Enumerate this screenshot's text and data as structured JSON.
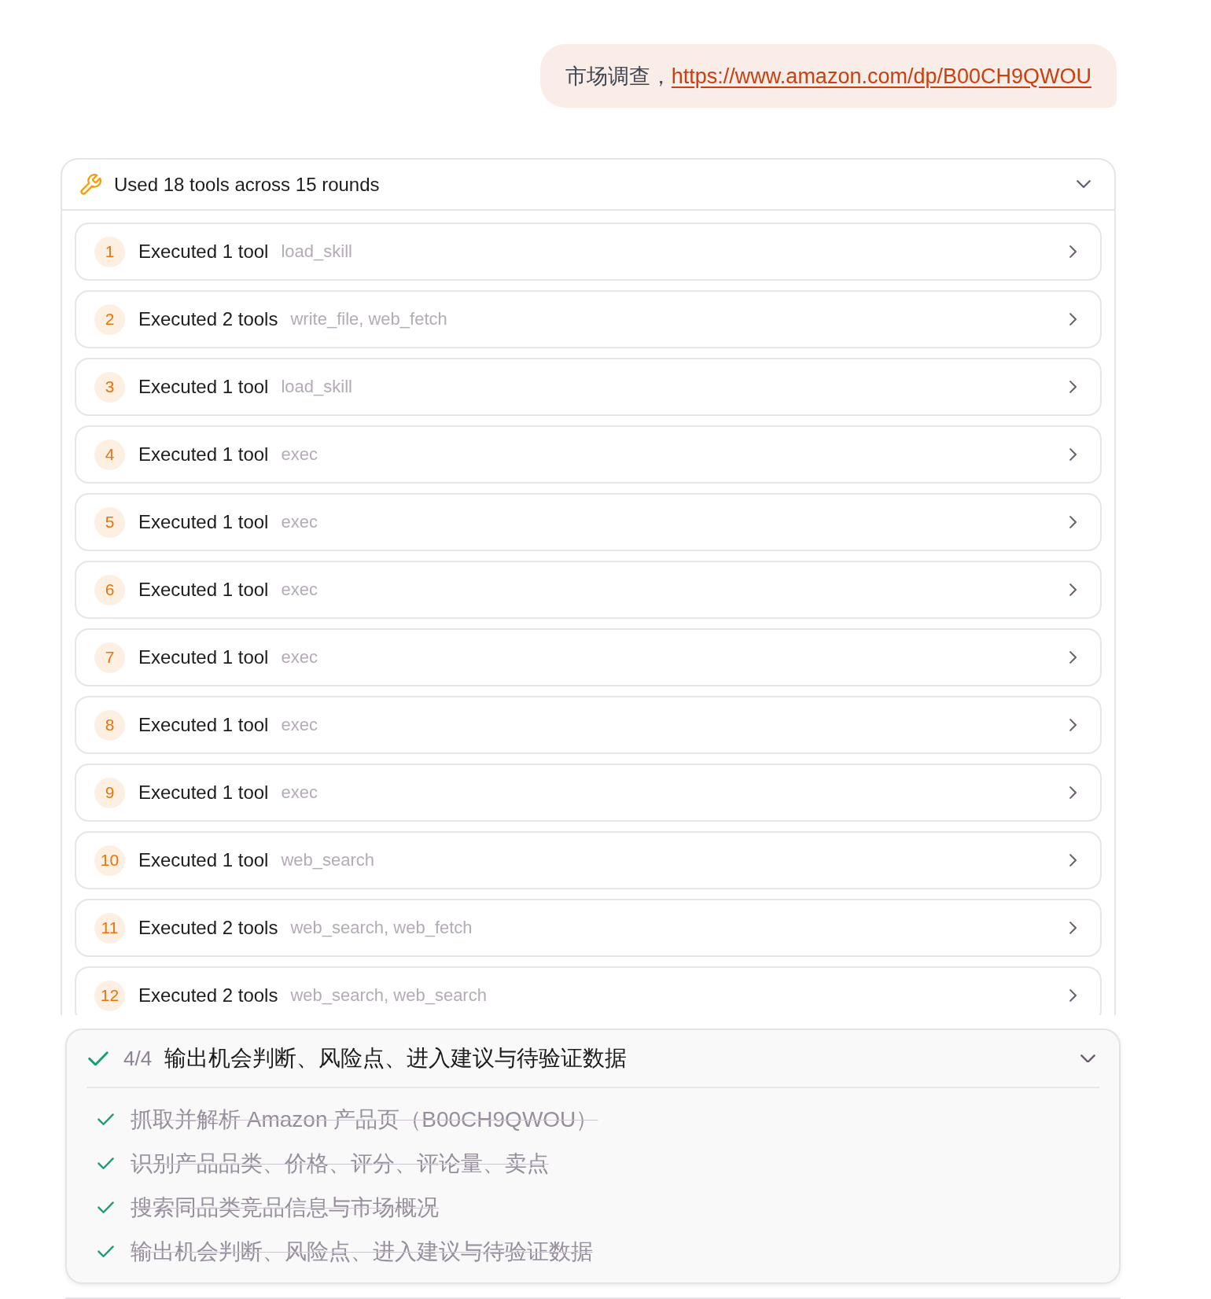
{
  "user_message": {
    "text": "市场调查，",
    "link": "https://www.amazon.com/dp/B00CH9QWOU"
  },
  "tool_summary": {
    "title": "Used 18 tools across 15 rounds",
    "expanded": true,
    "rounds": [
      {
        "number": "1",
        "label": "Executed 1 tool",
        "tools": "load_skill",
        "expanded": false
      },
      {
        "number": "2",
        "label": "Executed 2 tools",
        "tools": "write_file, web_fetch",
        "expanded": false
      },
      {
        "number": "3",
        "label": "Executed 1 tool",
        "tools": "load_skill",
        "expanded": false
      },
      {
        "number": "4",
        "label": "Executed 1 tool",
        "tools": "exec",
        "expanded": false
      },
      {
        "number": "5",
        "label": "Executed 1 tool",
        "tools": "exec",
        "expanded": false
      },
      {
        "number": "6",
        "label": "Executed 1 tool",
        "tools": "exec",
        "expanded": false
      },
      {
        "number": "7",
        "label": "Executed 1 tool",
        "tools": "exec",
        "expanded": false
      },
      {
        "number": "8",
        "label": "Executed 1 tool",
        "tools": "exec",
        "expanded": false
      },
      {
        "number": "9",
        "label": "Executed 1 tool",
        "tools": "exec",
        "expanded": false
      },
      {
        "number": "10",
        "label": "Executed 1 tool",
        "tools": "web_search",
        "expanded": false
      },
      {
        "number": "11",
        "label": "Executed 2 tools",
        "tools": "web_search, web_fetch",
        "expanded": false
      },
      {
        "number": "12",
        "label": "Executed 2 tools",
        "tools": "web_search, web_search",
        "expanded": false
      }
    ]
  },
  "todo_panel": {
    "complete": true,
    "progress": "4/4",
    "title": "输出机会判断、风险点、进入建议与待验证数据",
    "expanded": true,
    "items": [
      {
        "text": "抓取并解析 Amazon 产品页（B00CH9QWOU）",
        "done": true
      },
      {
        "text": "识别产品品类、价格、评分、评论量、卖点",
        "done": true
      },
      {
        "text": "搜索同品类竞品信息与市场概况",
        "done": true
      },
      {
        "text": "输出机会判断、风险点、进入建议与待验证数据",
        "done": true
      }
    ]
  }
}
